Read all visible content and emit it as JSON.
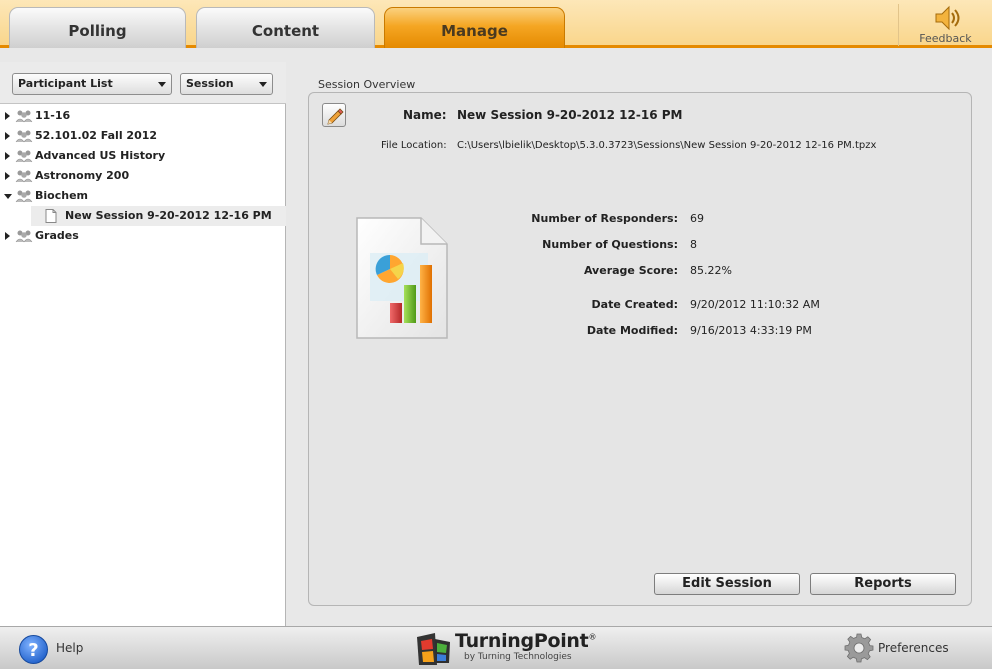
{
  "tabs": [
    {
      "label": "Polling"
    },
    {
      "label": "Content"
    },
    {
      "label": "Manage"
    }
  ],
  "feedback_label": "Feedback",
  "left": {
    "dropdowns": {
      "list": "Participant List",
      "session": "Session"
    },
    "tree": [
      {
        "label": "11-16"
      },
      {
        "label": "52.101.02 Fall 2012"
      },
      {
        "label": "Advanced US History"
      },
      {
        "label": "Astronomy 200"
      },
      {
        "label": "Biochem"
      },
      {
        "label": "New Session 9-20-2012 12-16 PM"
      },
      {
        "label": "Grades"
      }
    ]
  },
  "overview": {
    "title": "Session Overview",
    "name_label": "Name:",
    "name_value": "New Session 9-20-2012 12-16 PM",
    "location_label": "File Location:",
    "location_value": "C:\\Users\\lbielik\\Desktop\\5.3.0.3723\\Sessions\\New Session 9-20-2012 12-16 PM.tpzx",
    "stats": [
      {
        "label": "Number of Responders:",
        "value": "69"
      },
      {
        "label": "Number of Questions:",
        "value": "8"
      },
      {
        "label": "Average Score:",
        "value": "85.22%"
      },
      {
        "label": "Date Created:",
        "value": "9/20/2012 11:10:32 AM"
      },
      {
        "label": "Date Modified:",
        "value": "9/16/2013 4:33:19 PM"
      }
    ],
    "edit_session_label": "Edit Session",
    "reports_label": "Reports"
  },
  "bottom": {
    "help_label": "Help",
    "brand_name": "TurningPoint",
    "brand_reg": "®",
    "brand_sub": "by  Turning Technologies",
    "preferences_label": "Preferences"
  },
  "colors": {
    "accent": "#e58a00",
    "active_tab": "#f5a623",
    "topbar": "#fbe0a6"
  }
}
